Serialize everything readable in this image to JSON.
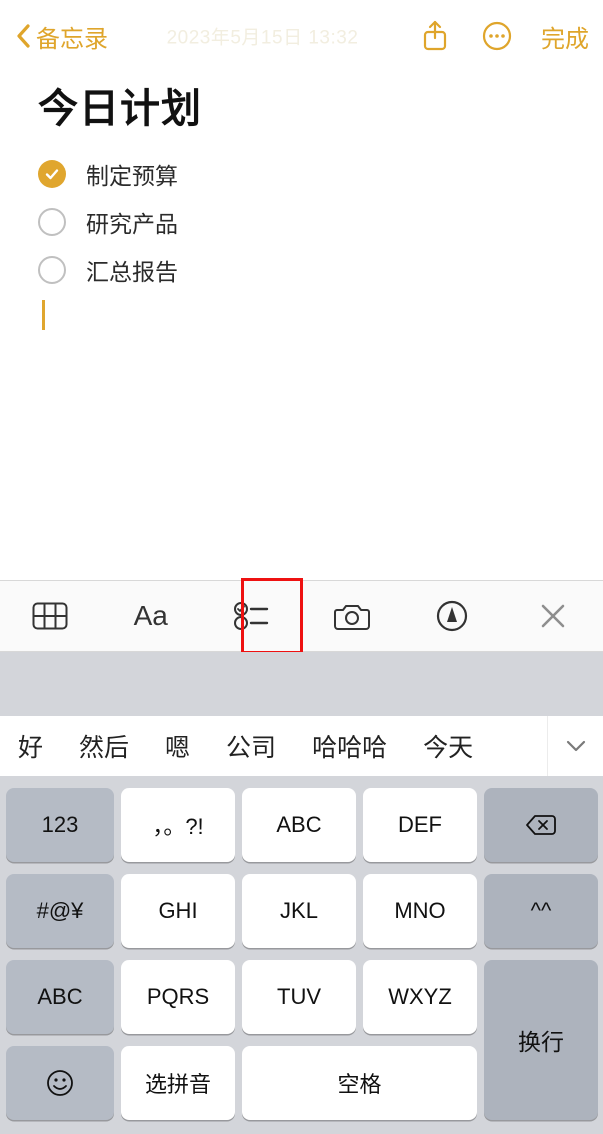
{
  "header": {
    "back_label": "备忘录",
    "ghost_date": "2023年5月15日 13:32",
    "done_label": "完成"
  },
  "note": {
    "title": "今日计划",
    "todos": [
      {
        "text": "制定预算",
        "checked": true
      },
      {
        "text": "研究产品",
        "checked": false
      },
      {
        "text": "汇总报告",
        "checked": false
      }
    ]
  },
  "fmt_toolbar": {
    "aa_label": "Aa"
  },
  "candidates": [
    "好",
    "然后",
    "嗯",
    "公司",
    "哈哈哈",
    "今天"
  ],
  "keyboard": {
    "row1": {
      "left": "123",
      "k1": "，。?!",
      "k2": "ABC",
      "k3": "DEF"
    },
    "row2": {
      "left": "#@¥",
      "k1": "GHI",
      "k2": "JKL",
      "k3": "MNO",
      "right": "^^"
    },
    "row3": {
      "left": "ABC",
      "k1": "PQRS",
      "k2": "TUV",
      "k3": "WXYZ"
    },
    "row4": {
      "k1": "选拼音",
      "space": "空格"
    },
    "return_label": "换行"
  }
}
